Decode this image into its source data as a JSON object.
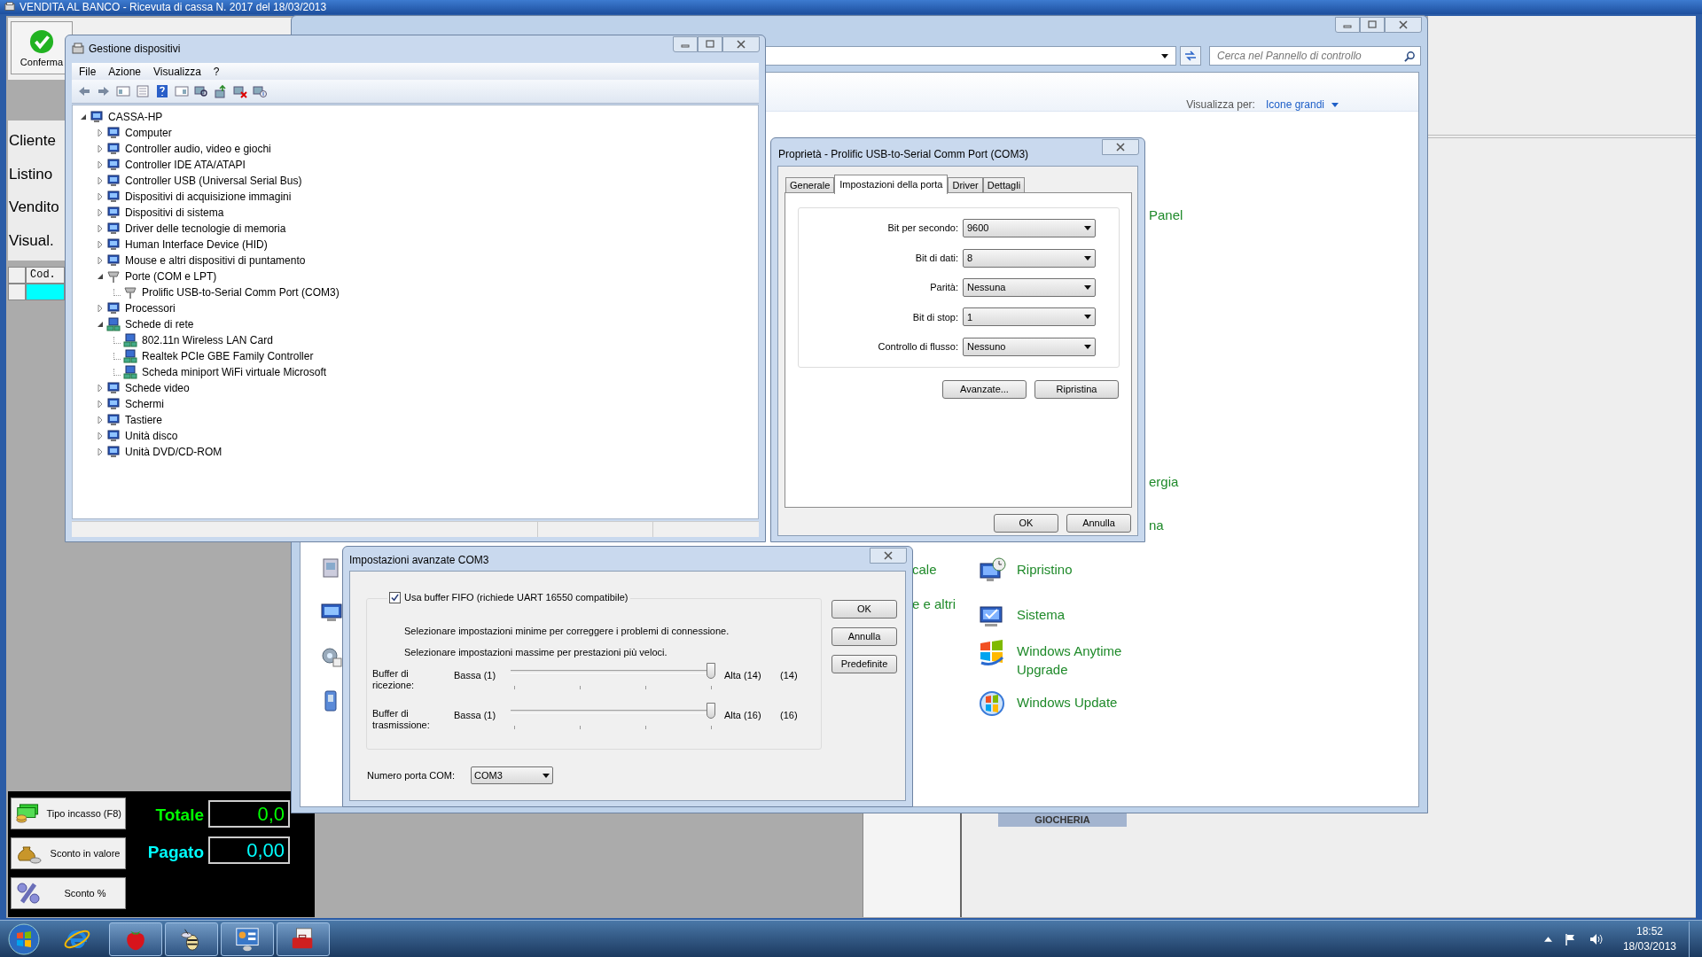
{
  "app_window": {
    "title": "VENDITA AL BANCO - Ricevuta di cassa N. 2017 del 18/03/2013",
    "toolbar_buttons": [
      {
        "label": "Conferma"
      }
    ],
    "side_buttons": [
      "Cliente",
      "Listino",
      "Vendito",
      "Visual."
    ],
    "grid": {
      "columns": [
        "Cod."
      ]
    },
    "payment_buttons": [
      "Tipo incasso (F8)",
      "Sconto in valore",
      "Sconto %"
    ],
    "totals": [
      {
        "label": "Totale",
        "value": "0,0",
        "color": "#00ff00"
      },
      {
        "label": "Pagato",
        "value": "0,00",
        "color": "#00ffff"
      }
    ],
    "category_tab": "GIOCHERIA"
  },
  "control_panel": {
    "search": {
      "placeholder": "Cerca nel Pannello di controllo"
    },
    "view_by": {
      "label": "Visualizza per:",
      "value": "Icone grandi"
    },
    "items": [
      {
        "label": "Panel"
      },
      {
        "label": "ergia"
      },
      {
        "label": "na"
      },
      {
        "label": "cale"
      },
      {
        "label": "Ripristino"
      },
      {
        "label": "e e altri"
      },
      {
        "label": "Sistema"
      },
      {
        "label": "Windows Anytime Upgrade"
      },
      {
        "label": "Windows Update"
      }
    ]
  },
  "device_manager": {
    "title": "Gestione dispositivi",
    "menu": [
      "File",
      "Azione",
      "Visualizza",
      "?"
    ],
    "tree": [
      {
        "label": "CASSA-HP",
        "expanded": true,
        "children": [
          {
            "label": "Computer",
            "expanded": false
          },
          {
            "label": "Controller audio, video e giochi",
            "expanded": false
          },
          {
            "label": "Controller IDE ATA/ATAPI",
            "expanded": false
          },
          {
            "label": "Controller USB (Universal Serial Bus)",
            "expanded": false
          },
          {
            "label": "Dispositivi di acquisizione immagini",
            "expanded": false
          },
          {
            "label": "Dispositivi di sistema",
            "expanded": false
          },
          {
            "label": "Driver delle tecnologie di memoria",
            "expanded": false
          },
          {
            "label": "Human Interface Device (HID)",
            "expanded": false
          },
          {
            "label": "Mouse e altri dispositivi di puntamento",
            "expanded": false
          },
          {
            "label": "Porte (COM e LPT)",
            "expanded": true,
            "children": [
              {
                "label": "Prolific USB-to-Serial Comm Port (COM3)"
              }
            ]
          },
          {
            "label": "Processori",
            "expanded": false
          },
          {
            "label": "Schede di rete",
            "expanded": true,
            "children": [
              {
                "label": "802.11n Wireless LAN Card"
              },
              {
                "label": "Realtek PCIe GBE Family Controller"
              },
              {
                "label": "Scheda miniport WiFi virtuale Microsoft"
              }
            ]
          },
          {
            "label": "Schede video",
            "expanded": false
          },
          {
            "label": "Schermi",
            "expanded": false
          },
          {
            "label": "Tastiere",
            "expanded": false
          },
          {
            "label": "Unità disco",
            "expanded": false
          },
          {
            "label": "Unità DVD/CD-ROM",
            "expanded": false
          }
        ]
      }
    ]
  },
  "properties_dialog": {
    "title": "Proprietà - Prolific USB-to-Serial Comm Port (COM3)",
    "tabs": [
      {
        "label": "Generale",
        "selected": false
      },
      {
        "label": "Impostazioni della porta",
        "selected": true
      },
      {
        "label": "Driver",
        "selected": false
      },
      {
        "label": "Dettagli",
        "selected": false
      }
    ],
    "fields": [
      {
        "label": "Bit per secondo:",
        "value": "9600"
      },
      {
        "label": "Bit di dati:",
        "value": "8"
      },
      {
        "label": "Parità:",
        "value": "Nessuna"
      },
      {
        "label": "Bit di stop:",
        "value": "1"
      },
      {
        "label": "Controllo di flusso:",
        "value": "Nessuno"
      }
    ],
    "buttons": [
      "Avanzate...",
      "Ripristina"
    ],
    "footer_buttons": [
      "OK",
      "Annulla"
    ]
  },
  "advanced_dialog": {
    "title": "Impostazioni avanzate COM3",
    "fifo": {
      "label": "Usa buffer FIFO (richiede UART 16550 compatibile)",
      "checked": true
    },
    "notes": [
      "Selezionare impostazioni minime per correggere i problemi di connessione.",
      "Selezionare impostazioni massime per prestazioni più veloci."
    ],
    "sliders": [
      {
        "label": "Buffer di ricezione:",
        "min_label": "Bassa (1)",
        "max_label": "Alta (14)",
        "reading": "(14)",
        "level": 1
      },
      {
        "label": "Buffer di trasmissione:",
        "min_label": "Bassa (1)",
        "max_label": "Alta (16)",
        "reading": "(16)",
        "level": 1
      }
    ],
    "port": {
      "label": "Numero porta COM:",
      "value": "COM3"
    },
    "buttons": [
      "OK",
      "Annulla",
      "Predefinite"
    ]
  },
  "taskbar": {
    "clock": {
      "time": "18:52",
      "date": "18/03/2013"
    }
  }
}
